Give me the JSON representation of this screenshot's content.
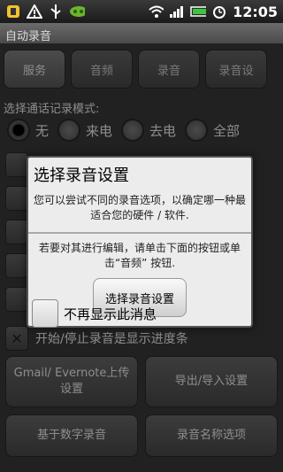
{
  "status_bar": {
    "time": "12:05",
    "icons_left": [
      "notification-icon",
      "warning-icon",
      "usb-icon",
      "app-icon"
    ],
    "icons_right": [
      "wifi-icon",
      "signal-icon",
      "battery-icon",
      "alarm-icon"
    ]
  },
  "app": {
    "title": "自动录音",
    "tabs": [
      {
        "label": "服务",
        "active": true
      },
      {
        "label": "音频",
        "active": false
      },
      {
        "label": "录音",
        "active": false
      },
      {
        "label": "录音设",
        "active": false
      }
    ],
    "mode_label": "选择通话记录模式:",
    "mode_options": [
      "无",
      "来电",
      "去电",
      "全部"
    ],
    "mode_selected": "无",
    "progress_checkbox_label": "开始/停止录音是显示进度条",
    "buttons": [
      {
        "label": "Gmail/ Evernote上传设置"
      },
      {
        "label": "导出/导入设置"
      },
      {
        "label": "基于数字录音"
      },
      {
        "label": "录音名称选项"
      }
    ]
  },
  "dialog": {
    "title": "选择录音设置",
    "message": "您可以尝试不同的录音选项，以确定哪一种最适合您的硬件 / 软件.",
    "message2": "若要对其进行编辑，请单击下面的按钮或单击“音频” 按钮.",
    "button_label": "选择录音设置",
    "checkbox_label": "不再显示此消息"
  }
}
